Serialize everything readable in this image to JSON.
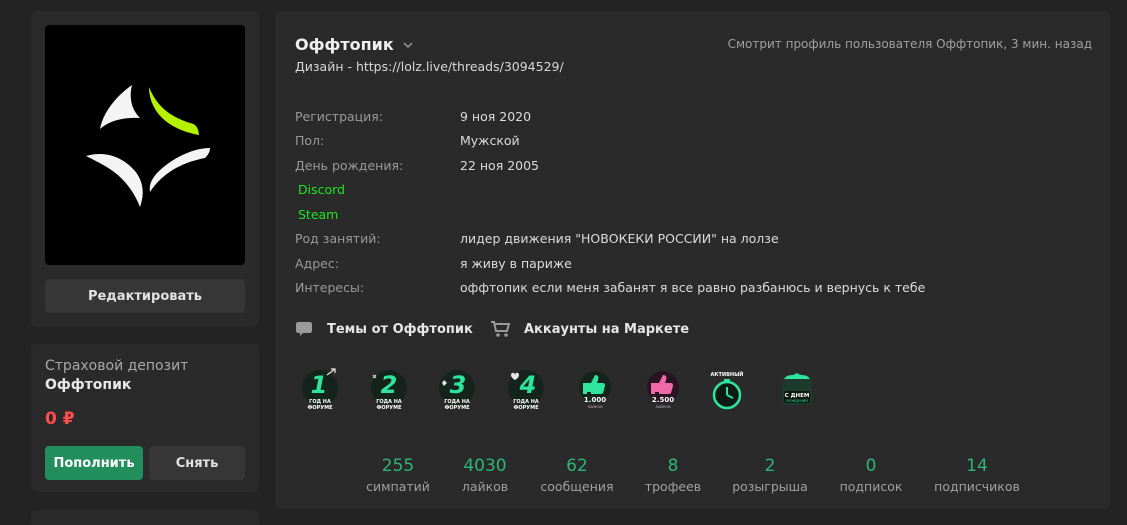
{
  "sidebar": {
    "edit_button": "Редактировать",
    "deposit": {
      "title": "Страховой депозит",
      "username": "Оффтопик",
      "amount": "0 ₽",
      "topup_button": "Пополнить",
      "withdraw_button": "Снять"
    }
  },
  "profile": {
    "username": "Оффтопик",
    "status": "Дизайн - https://lolz.live/threads/3094529/",
    "last_seen": "Смотрит профиль пользователя Оффтопик, 3 мин. назад",
    "info": [
      {
        "label": "Регистрация:",
        "value": "9 ноя 2020"
      },
      {
        "label": "Пол:",
        "value": "Мужской"
      },
      {
        "label": "День рождения:",
        "value": "22 ноя 2005"
      },
      {
        "label": "Род занятий:",
        "value": "лидер движения \"НОВОКЕКИ РОССИИ\" на лолзе"
      },
      {
        "label": "Адрес:",
        "value": "я живу в париже"
      },
      {
        "label": "Интересы:",
        "value": "оффтопик если меня забанят я все равно разбанюсь и вернусь к тебе"
      }
    ],
    "links": [
      "Discord",
      "Steam"
    ],
    "actions": {
      "threads": "Темы от Оффтопик",
      "market": "Аккаунты на Маркете"
    },
    "trophies": [
      {
        "number": "1",
        "caption1": "ГОД НА",
        "caption2": "ФОРУМЕ",
        "icon": "year-1-trophy-icon"
      },
      {
        "number": "2",
        "caption1": "ГОДА НА",
        "caption2": "ФОРУМЕ",
        "icon": "year-2-trophy-icon"
      },
      {
        "number": "3",
        "caption1": "ГОДА НА",
        "caption2": "ФОРУМЕ",
        "icon": "year-3-trophy-icon"
      },
      {
        "number": "4",
        "caption1": "ГОДА НА",
        "caption2": "ФОРУМЕ",
        "icon": "year-4-trophy-icon"
      },
      {
        "number": "1.000",
        "caption1": "ЛАЙКОВ",
        "caption2": "",
        "icon": "likes-1000-trophy-icon"
      },
      {
        "number": "2.500",
        "caption1": "ЛАЙКОВ",
        "caption2": "",
        "icon": "likes-2500-trophy-icon"
      },
      {
        "number": "",
        "caption1": "АКТИВНЫЙ",
        "caption2": "",
        "icon": "active-stopwatch-trophy-icon"
      },
      {
        "number": "",
        "caption1": "С ДНЕМ",
        "caption2": "РОЖДЕНИЯ",
        "icon": "birthday-cake-trophy-icon"
      }
    ],
    "stats": [
      {
        "value": "255",
        "label": "симпатий"
      },
      {
        "value": "4030",
        "label": "лайков"
      },
      {
        "value": "62",
        "label": "сообщения"
      },
      {
        "value": "8",
        "label": "трофеев"
      },
      {
        "value": "2",
        "label": "розыгрыша"
      },
      {
        "value": "0",
        "label": "подписок"
      },
      {
        "value": "14",
        "label": "подписчиков"
      }
    ]
  },
  "colors": {
    "accent_green": "#2bb67a",
    "link_green": "#1fe51f",
    "amount_red": "#ff4c4c",
    "logo_lime": "#b6f200"
  }
}
